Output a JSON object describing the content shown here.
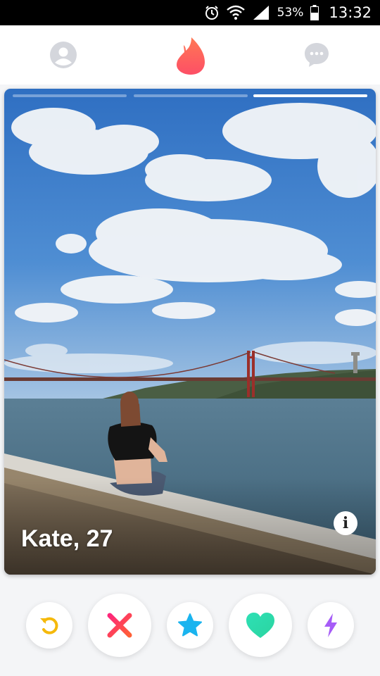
{
  "status_bar": {
    "battery": "53%",
    "time": "13:32",
    "icons": [
      "alarm-icon",
      "wifi-icon",
      "signal-icon",
      "battery-icon"
    ]
  },
  "header": {
    "icons": [
      "profile-icon",
      "flame-logo-icon",
      "chat-bubble-icon"
    ],
    "colors": {
      "inactive": "#d4d6dc",
      "brand": "#fe5f5f"
    }
  },
  "card": {
    "name_age": "Kate, 27",
    "photo_count": 3,
    "current_photo": 3,
    "info_icon": "info-icon"
  },
  "actions": [
    {
      "name": "rewind",
      "icon": "rewind-icon",
      "color": "#f5b90b"
    },
    {
      "name": "nope",
      "icon": "x-icon",
      "color": "#fd5068"
    },
    {
      "name": "super-like",
      "icon": "star-icon",
      "color": "#1ab4ef"
    },
    {
      "name": "like",
      "icon": "heart-icon",
      "color": "#2ee0b5"
    },
    {
      "name": "boost",
      "icon": "lightning-bolt-icon",
      "color": "#a65cf7"
    }
  ]
}
